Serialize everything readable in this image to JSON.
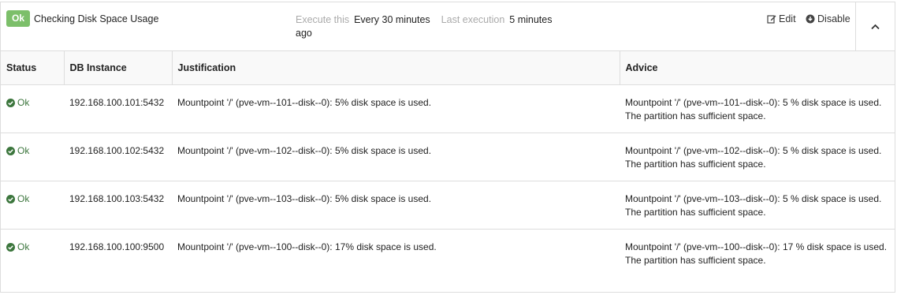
{
  "check": {
    "badge": "Ok",
    "title": "Checking Disk Space Usage",
    "execute_label": "Execute this",
    "execute_value": "Every 30 minutes",
    "last_execution_label": "Last execution",
    "last_execution_value": "5 minutes ago"
  },
  "actions": {
    "edit": "Edit",
    "disable": "Disable"
  },
  "table": {
    "headers": [
      "Status",
      "DB Instance",
      "Justification",
      "Advice"
    ],
    "rows": [
      {
        "status": "Ok",
        "instance": "192.168.100.101:5432",
        "justification": "Mountpoint '/' (pve-vm--101--disk--0): 5% disk space is used.",
        "advice": "Mountpoint '/' (pve-vm--101--disk--0): 5 % disk space is used. The partition has sufficient space."
      },
      {
        "status": "Ok",
        "instance": "192.168.100.102:5432",
        "justification": "Mountpoint '/' (pve-vm--102--disk--0): 5% disk space is used.",
        "advice": "Mountpoint '/' (pve-vm--102--disk--0): 5 % disk space is used. The partition has sufficient space."
      },
      {
        "status": "Ok",
        "instance": "192.168.100.103:5432",
        "justification": "Mountpoint '/' (pve-vm--103--disk--0): 5% disk space is used.",
        "advice": "Mountpoint '/' (pve-vm--103--disk--0): 5 % disk space is used. The partition has sufficient space."
      },
      {
        "status": "Ok",
        "instance": "192.168.100.100:9500",
        "justification": "Mountpoint '/' (pve-vm--100--disk--0): 17% disk space is used.",
        "advice": "Mountpoint '/' (pve-vm--100--disk--0): 17 % disk space is used. The partition has sufficient space."
      }
    ]
  },
  "colors": {
    "ok_badge": "#7cbf6a",
    "ok_text": "#3c763d",
    "muted": "#aaaaaa",
    "border": "#dddddd"
  },
  "icons": {
    "edit": "edit-icon",
    "disable": "disable-icon",
    "collapse": "chevron-up-icon",
    "status_ok": "check-circle-icon"
  }
}
